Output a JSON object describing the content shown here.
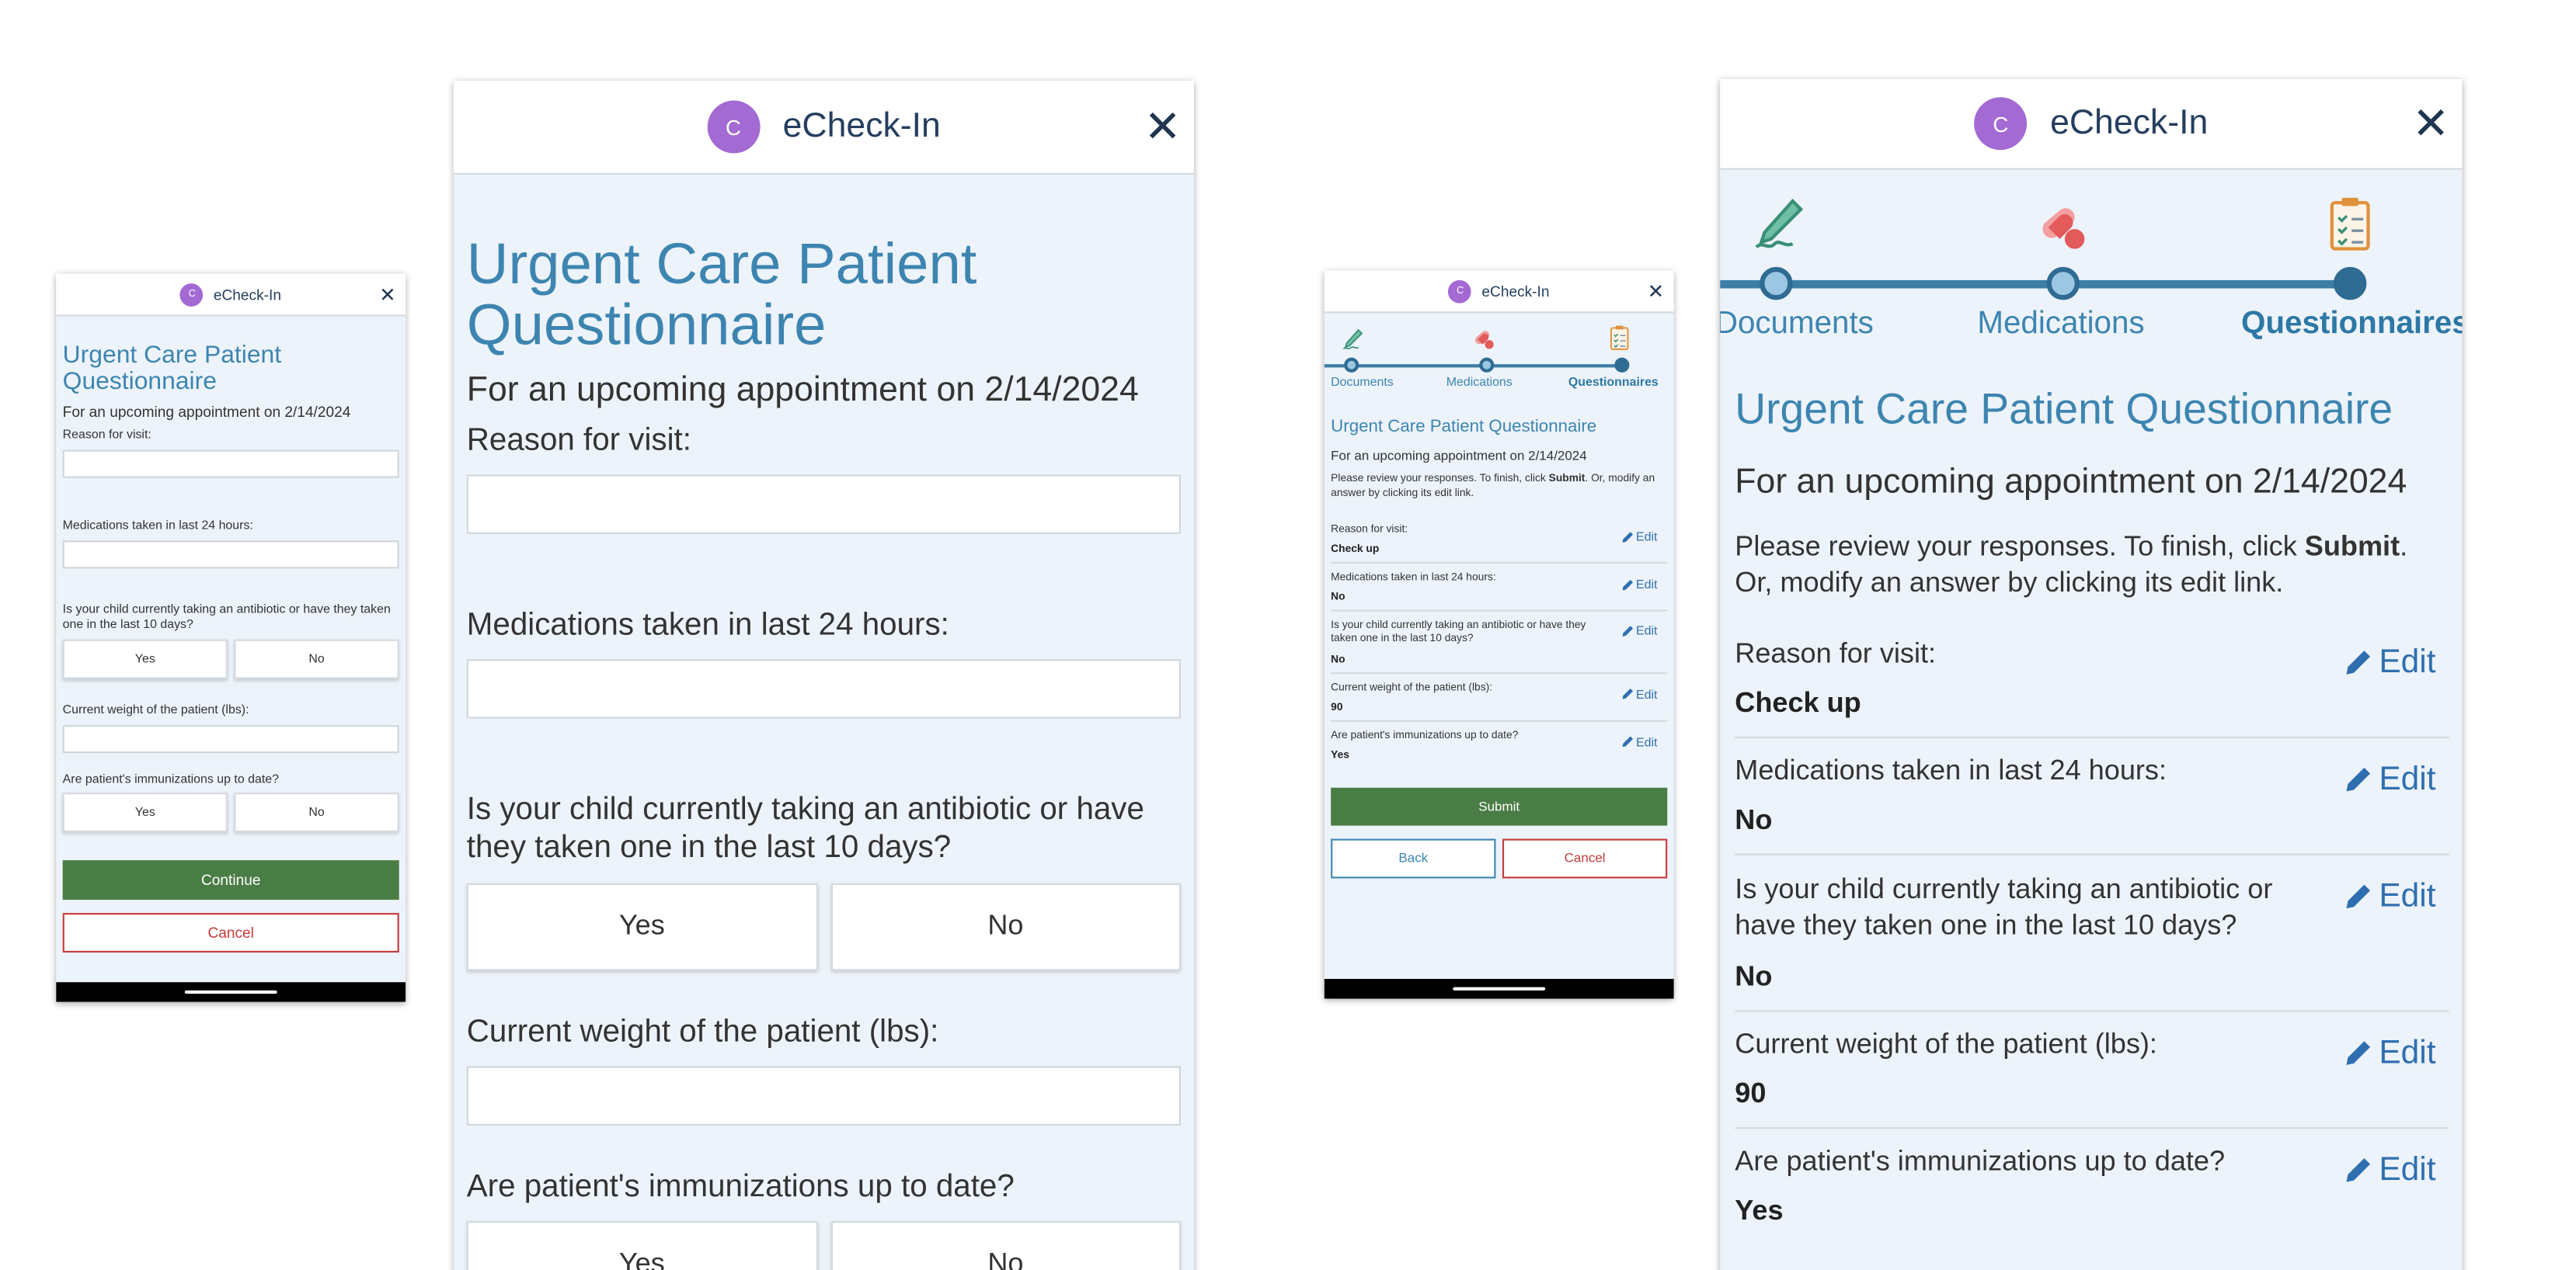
{
  "header": {
    "avatar_letter": "C",
    "title": "eCheck-In",
    "close_glyph": "✕"
  },
  "questionnaire": {
    "title": "Urgent Care Patient Questionnaire",
    "appointment": "For an upcoming appointment on 2/14/2024",
    "reason_label": "Reason for visit:",
    "reason_value": "",
    "meds_label": "Medications taken in last 24 hours:",
    "meds_value": "",
    "antibiotic_label": "Is your child currently taking an antibiotic or have they taken one in the last 10 days?",
    "weight_label": "Current weight of the patient (lbs):",
    "weight_value": "",
    "immunizations_label": "Are patient's immunizations up to date?",
    "yes_label": "Yes",
    "no_label": "No",
    "continue_label": "Continue",
    "cancel_label": "Cancel"
  },
  "steps": [
    {
      "label": "Documents",
      "icon": "pen-icon",
      "state": "complete"
    },
    {
      "label": "Medications",
      "icon": "pill-icon",
      "state": "complete"
    },
    {
      "label": "Questionnaires",
      "icon": "clipboard-icon",
      "state": "active"
    }
  ],
  "review": {
    "instructions_prefix": "Please review your responses. To finish, click ",
    "instructions_bold": "Submit",
    "instructions_suffix": ". Or, modify an answer by clicking its edit link.",
    "edit_label": "Edit",
    "items": [
      {
        "question": "Reason for visit:",
        "answer": "Check up"
      },
      {
        "question": "Medications taken in last 24 hours:",
        "answer": "No"
      },
      {
        "question": "Is your child currently taking an antibiotic or have they taken one in the last 10 days?",
        "answer": "No"
      },
      {
        "question": "Current weight of the patient (lbs):",
        "answer": "90"
      },
      {
        "question": "Are patient's immunizations up to date?",
        "answer": "Yes"
      }
    ],
    "submit_label": "Submit",
    "back_label": "Back",
    "cancel_label": "Cancel"
  },
  "colors": {
    "accent": "#3d85b0",
    "header_text": "#243e5e",
    "avatar": "#a46ad3",
    "continue": "#4a7d45",
    "cancel": "#c53b3b",
    "background": "#edf3fa"
  }
}
